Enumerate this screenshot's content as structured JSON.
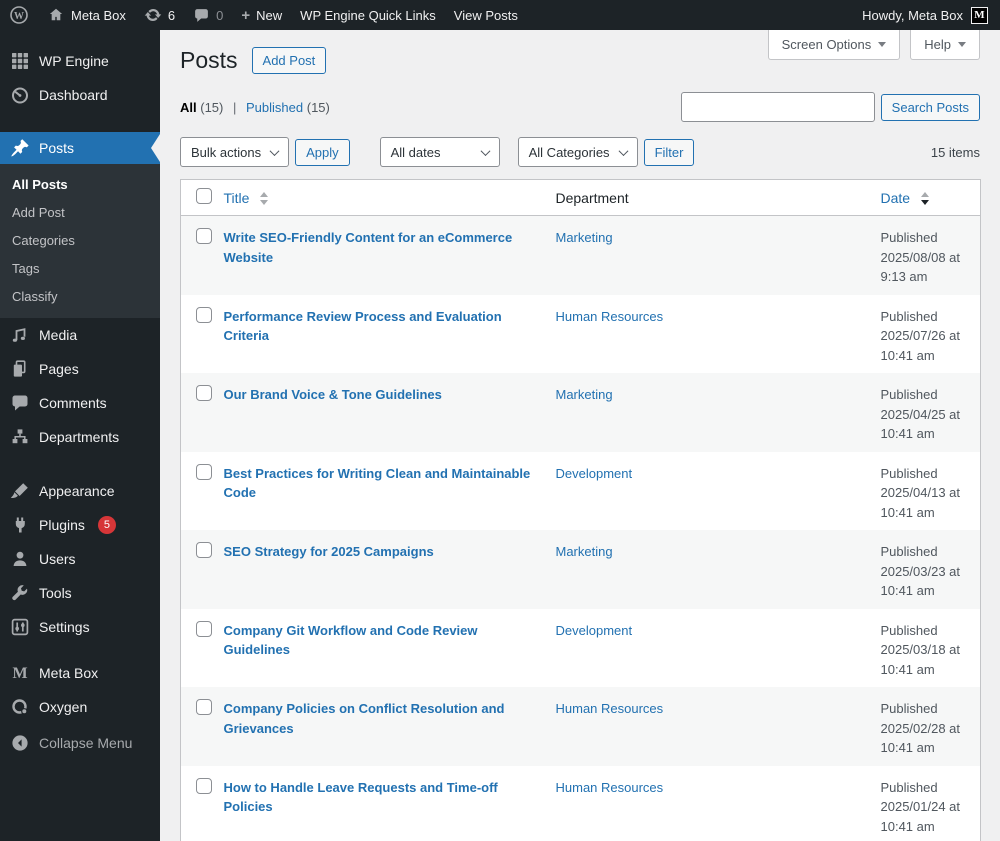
{
  "admin_bar": {
    "site_name": "Meta Box",
    "update_count": "6",
    "comment_count": "0",
    "new_label": "New",
    "wpe_quick_links": "WP Engine Quick Links",
    "view_posts": "View Posts",
    "howdy": "Howdy, Meta Box",
    "avatar_letter": "M"
  },
  "sidebar": {
    "wp_engine": "WP Engine",
    "dashboard": "Dashboard",
    "posts": "Posts",
    "submenu": {
      "all_posts": "All Posts",
      "add_post": "Add Post",
      "categories": "Categories",
      "tags": "Tags",
      "classify": "Classify"
    },
    "media": "Media",
    "pages": "Pages",
    "comments": "Comments",
    "departments": "Departments",
    "appearance": "Appearance",
    "plugins": "Plugins",
    "plugins_badge": "5",
    "users": "Users",
    "tools": "Tools",
    "settings": "Settings",
    "meta_box": "Meta Box",
    "oxygen": "Oxygen",
    "collapse": "Collapse Menu"
  },
  "screen_meta": {
    "screen_options": "Screen Options",
    "help": "Help"
  },
  "page": {
    "title": "Posts",
    "add_post": "Add Post"
  },
  "views": {
    "all": "All",
    "all_count": "(15)",
    "separator": "|",
    "published": "Published",
    "published_count": "(15)"
  },
  "search": {
    "button": "Search Posts",
    "value": ""
  },
  "filters": {
    "bulk_actions": "Bulk actions",
    "apply": "Apply",
    "all_dates": "All dates",
    "all_categories": "All Categories",
    "filter": "Filter",
    "items_count": "15 items"
  },
  "table": {
    "headers": {
      "title": "Title",
      "department": "Department",
      "date": "Date"
    },
    "rows": [
      {
        "title": "Write SEO-Friendly Content for an eCommerce Website",
        "department": "Marketing",
        "status": "Published",
        "date": "2025/08/08 at",
        "time": "9:13 am"
      },
      {
        "title": "Performance Review Process and Evaluation Criteria",
        "department": "Human Resources",
        "status": "Published",
        "date": "2025/07/26 at",
        "time": "10:41 am"
      },
      {
        "title": "Our Brand Voice & Tone Guidelines",
        "department": "Marketing",
        "status": "Published",
        "date": "2025/04/25 at",
        "time": "10:41 am"
      },
      {
        "title": "Best Practices for Writing Clean and Maintainable Code",
        "department": "Development",
        "status": "Published",
        "date": "2025/04/13 at",
        "time": "10:41 am"
      },
      {
        "title": "SEO Strategy for 2025 Campaigns",
        "department": "Marketing",
        "status": "Published",
        "date": "2025/03/23 at",
        "time": "10:41 am"
      },
      {
        "title": "Company Git Workflow and Code Review Guidelines",
        "department": "Development",
        "status": "Published",
        "date": "2025/03/18 at",
        "time": "10:41 am"
      },
      {
        "title": "Company Policies on Conflict Resolution and Grievances",
        "department": "Human Resources",
        "status": "Published",
        "date": "2025/02/28 at",
        "time": "10:41 am"
      },
      {
        "title": "How to Handle Leave Requests and Time-off Policies",
        "department": "Human Resources",
        "status": "Published",
        "date": "2025/01/24 at",
        "time": "10:41 am"
      }
    ]
  },
  "colors": {
    "accent": "#2271b1",
    "badge": "#d63638",
    "admin_dark": "#1d2327",
    "submenu_bg": "#2c3338",
    "alt_row": "#f6f7f7"
  }
}
